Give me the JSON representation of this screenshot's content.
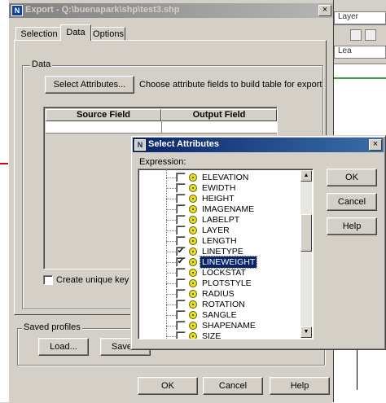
{
  "main_window": {
    "title": "Export - Q:\\buenapark\\shp\\test3.shp",
    "tabs": [
      "Selection",
      "Data",
      "Options"
    ],
    "data_group_title": "Data",
    "select_attributes_button": "Select Attributes...",
    "select_attributes_hint": "Choose attribute fields to build table for export",
    "table_headers": [
      "Source Field",
      "Output Field"
    ],
    "unique_key_checkbox_label": "Create unique key field",
    "saved_profiles_title": "Saved profiles",
    "load_button": "Load...",
    "save_button": "Save...",
    "ok_button": "OK",
    "cancel_button": "Cancel",
    "help_button": "Help"
  },
  "background_app": {
    "layer_label": "Layer",
    "leader_label": "Lea"
  },
  "dialog": {
    "title": "Select Attributes",
    "expression_label": "Expression:",
    "ok_button": "OK",
    "cancel_button": "Cancel",
    "help_button": "Help",
    "fields": [
      {
        "name": "ELEVATION",
        "checked": false,
        "selected": false
      },
      {
        "name": "EWIDTH",
        "checked": false,
        "selected": false
      },
      {
        "name": "HEIGHT",
        "checked": false,
        "selected": false
      },
      {
        "name": "IMAGENAME",
        "checked": false,
        "selected": false
      },
      {
        "name": "LABELPT",
        "checked": false,
        "selected": false
      },
      {
        "name": "LAYER",
        "checked": false,
        "selected": false
      },
      {
        "name": "LENGTH",
        "checked": false,
        "selected": false
      },
      {
        "name": "LINETYPE",
        "checked": true,
        "selected": false
      },
      {
        "name": "LINEWEIGHT",
        "checked": true,
        "selected": true
      },
      {
        "name": "LOCKSTAT",
        "checked": false,
        "selected": false
      },
      {
        "name": "PLOTSTYLE",
        "checked": false,
        "selected": false
      },
      {
        "name": "RADIUS",
        "checked": false,
        "selected": false
      },
      {
        "name": "ROTATION",
        "checked": false,
        "selected": false
      },
      {
        "name": "SANGLE",
        "checked": false,
        "selected": false
      },
      {
        "name": "SHAPENAME",
        "checked": false,
        "selected": false
      },
      {
        "name": "SIZE",
        "checked": false,
        "selected": false
      }
    ]
  }
}
